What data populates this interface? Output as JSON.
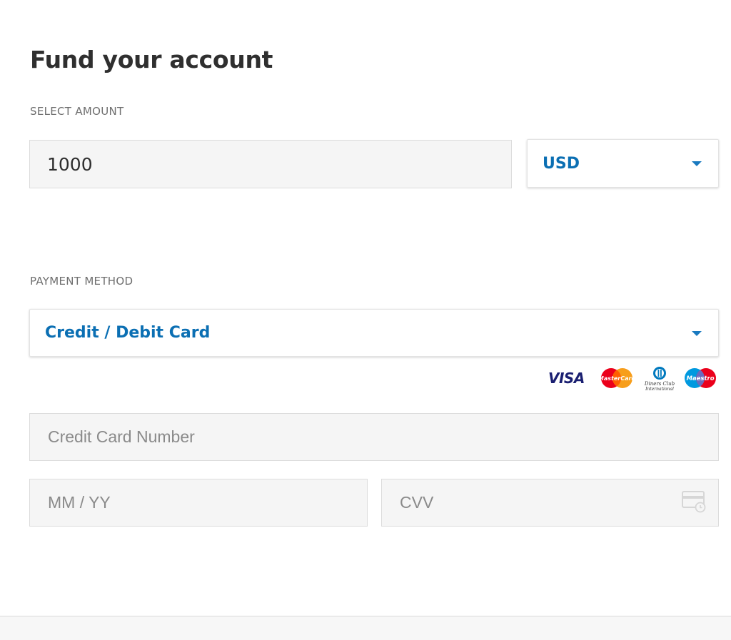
{
  "header": {
    "title": "Fund your account"
  },
  "amount": {
    "section_label": "SELECT AMOUNT",
    "value": "1000",
    "currency": "USD"
  },
  "payment": {
    "section_label": "PAYMENT METHOD",
    "method": "Credit / Debit Card",
    "card_brands": [
      "VISA",
      "MasterCard",
      "Diners Club International",
      "Maestro"
    ],
    "card_number_placeholder": "Credit Card Number",
    "expiry_placeholder": "MM / YY",
    "cvv_placeholder": "CVV"
  },
  "colors": {
    "accent": "#0b6fb3",
    "field_bg": "#f5f5f5",
    "visa": "#1a1f71",
    "mastercard_red": "#eb001b",
    "mastercard_orange": "#f79e1b",
    "diners_blue": "#0079be",
    "maestro_blue": "#0099df"
  },
  "icons": {
    "currency_caret": "chevron-down-icon",
    "method_caret": "chevron-down-icon",
    "cvv": "card-cvv-icon"
  }
}
